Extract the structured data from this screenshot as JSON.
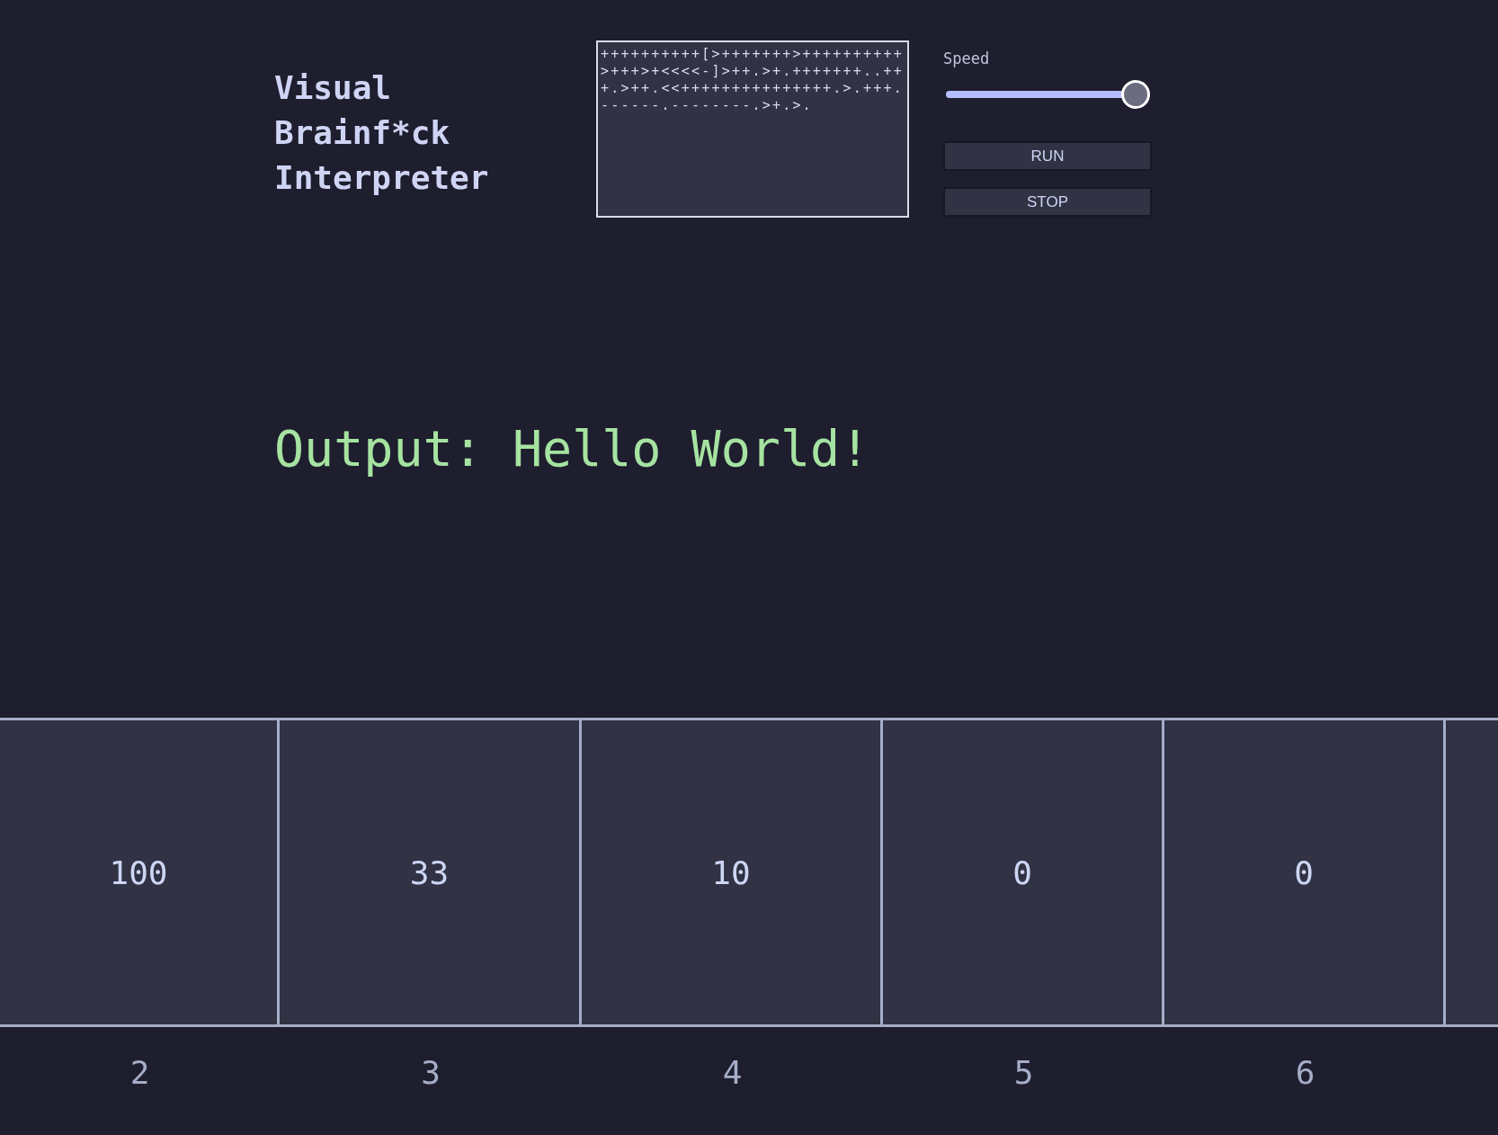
{
  "title": [
    "Visual",
    "Brainf*ck",
    "Interpreter"
  ],
  "code": {
    "value": "++++++++++[>+++++++>++++++++++>+++>+<<<<-]>++.>+.+++++++..+++.>++.<<+++++++++++++++.>.+++.------.--------.>+.>."
  },
  "speed": {
    "label": "Speed",
    "level": 1
  },
  "buttons": [
    {
      "label": "RUN"
    },
    {
      "label": "STOP"
    }
  ],
  "output": "Output: Hello World!",
  "tape": [
    {
      "value": "100",
      "index": "2"
    },
    {
      "value": "33",
      "index": "3"
    },
    {
      "value": "10",
      "index": "4"
    },
    {
      "value": "0",
      "index": "5"
    },
    {
      "value": "0",
      "index": "6"
    }
  ]
}
